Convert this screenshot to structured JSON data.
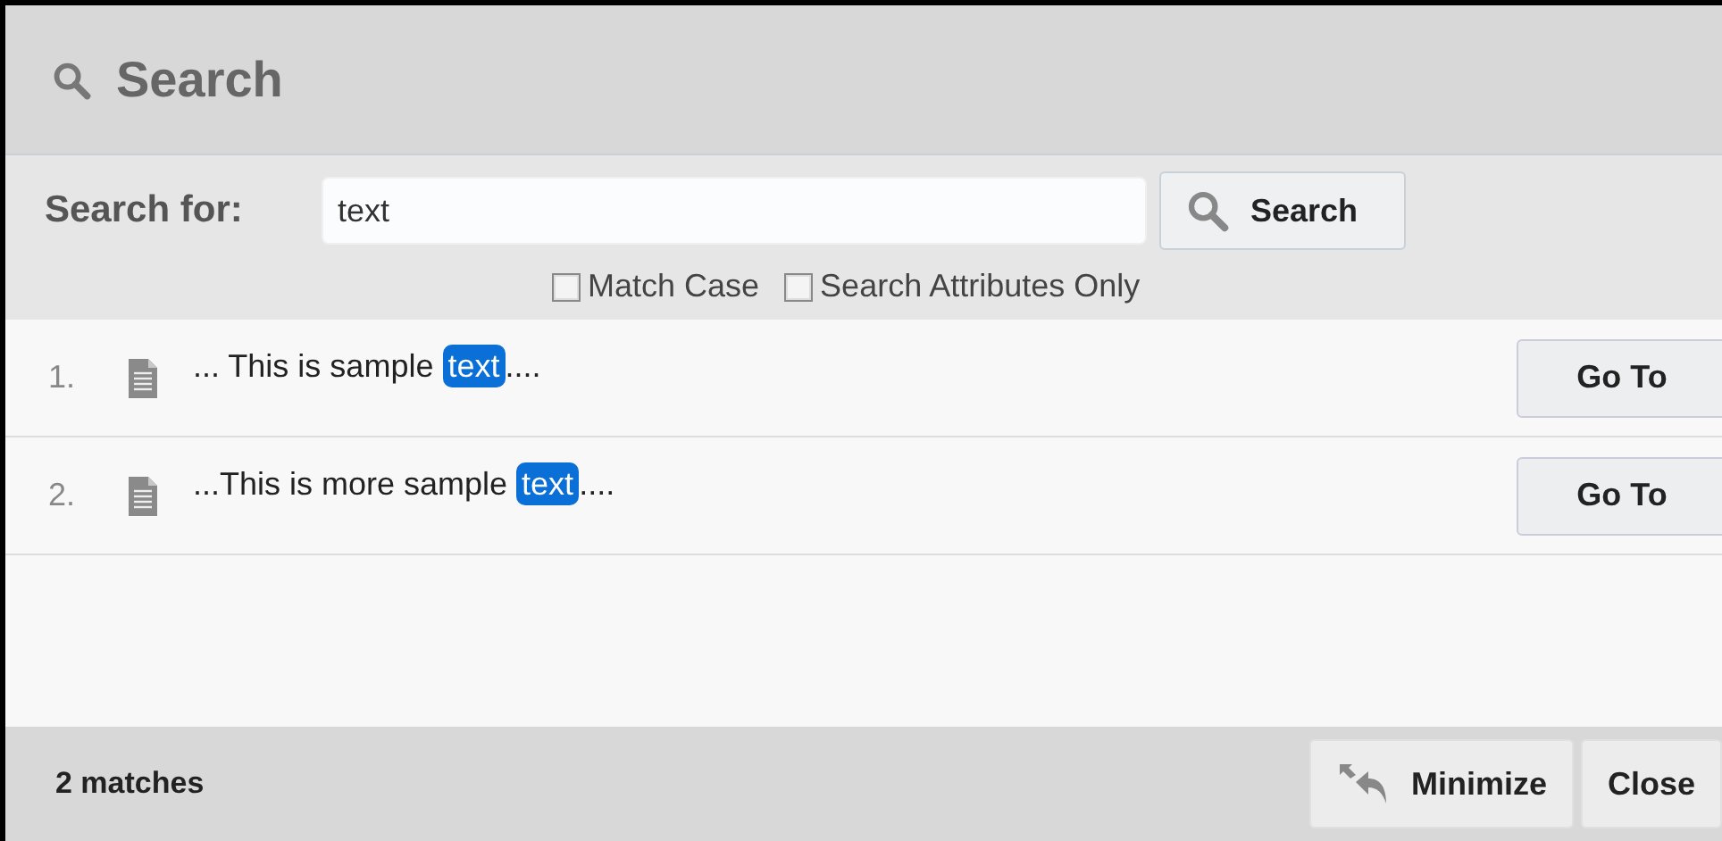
{
  "window": {
    "title": "Search"
  },
  "search": {
    "label": "Search for:",
    "value": "text",
    "button": "Search"
  },
  "options": [
    {
      "label": "Match Case",
      "checked": false
    },
    {
      "label": "Search Attributes Only",
      "checked": false
    }
  ],
  "results": [
    {
      "number": "1.",
      "before": "... This is sample ",
      "match": "text",
      "after": "....",
      "button": "Go To"
    },
    {
      "number": "2.",
      "before": "...This is more sample ",
      "match": "text",
      "after": "....",
      "button": "Go To"
    }
  ],
  "footer": {
    "count": "2 matches",
    "buttons": [
      {
        "kind": "minimize",
        "label": "Minimize"
      },
      {
        "kind": "close",
        "label": "Close"
      }
    ]
  }
}
